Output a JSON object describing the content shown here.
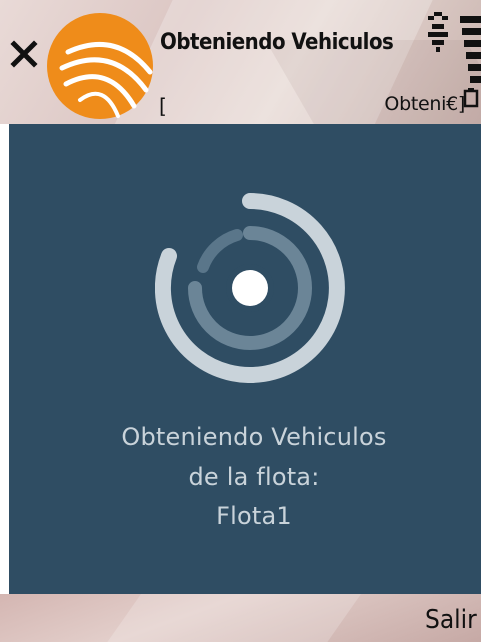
{
  "window": {
    "title": "Obteniendo Vehiculos",
    "bracket": "[",
    "status_text": "Obteni€]"
  },
  "icons": {
    "close": "close-icon",
    "logo": "app-logo",
    "network": "network-activity-icon",
    "signal": "signal-strength-icon",
    "battery": "battery-icon",
    "spinner": "loading-spinner"
  },
  "colors": {
    "content_bg": "#2f4d63",
    "logo_orange": "#ef8c1a",
    "message_text": "#c9d3da",
    "spinner_outer": "#c9d3da",
    "spinner_inner": "#6b8597"
  },
  "main": {
    "message_line1": "Obteniendo Vehiculos",
    "message_line2": "de la flota:",
    "message_line3": "Flota1"
  },
  "softkeys": {
    "right": "Salir"
  }
}
